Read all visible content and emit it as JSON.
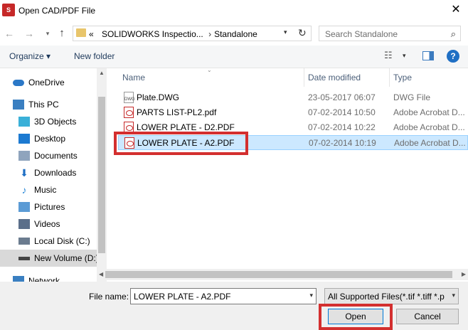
{
  "window": {
    "app_icon_text": "S",
    "title": "Open CAD/PDF File"
  },
  "address_bar": {
    "prefix": "«",
    "path": [
      "SOLIDWORKS Inspectio...",
      "Standalone"
    ],
    "separator": "›"
  },
  "search": {
    "placeholder": "Search Standalone"
  },
  "toolbar": {
    "organize_label": "Organize ▾",
    "new_folder_label": "New folder"
  },
  "sidebar": {
    "items": [
      {
        "label": "OneDrive",
        "icon": "onedrive-icon",
        "color": "#2b78c7"
      },
      {
        "label": "This PC",
        "icon": "computer-icon",
        "color": "#3a7fc1"
      },
      {
        "label": "3D Objects",
        "icon": "cube-icon",
        "color": "#3ab0d8"
      },
      {
        "label": "Desktop",
        "icon": "desktop-icon",
        "color": "#1c7ad1"
      },
      {
        "label": "Documents",
        "icon": "documents-icon",
        "color": "#8fa4bd"
      },
      {
        "label": "Downloads",
        "icon": "downloads-icon",
        "color": "#1f6fc4"
      },
      {
        "label": "Music",
        "icon": "music-icon",
        "color": "#2d8ad9"
      },
      {
        "label": "Pictures",
        "icon": "pictures-icon",
        "color": "#5b9bd5"
      },
      {
        "label": "Videos",
        "icon": "videos-icon",
        "color": "#5b6f8a"
      },
      {
        "label": "Local Disk (C:)",
        "icon": "local-disk-icon",
        "color": "#6b7c8f"
      },
      {
        "label": "New Volume (D:)",
        "icon": "drive-icon",
        "color": "#444444"
      },
      {
        "label": "Network",
        "icon": "network-icon",
        "color": "#3a7fc1"
      }
    ]
  },
  "file_list": {
    "columns": [
      "Name",
      "Date modified",
      "Type"
    ],
    "rows": [
      {
        "name": "Plate.DWG",
        "date": "23-05-2017 06:07",
        "type": "DWG File",
        "kind": "dwg"
      },
      {
        "name": "PARTS LIST-PL2.pdf",
        "date": "07-02-2014 10:50",
        "type": "Adobe Acrobat D...",
        "kind": "pdf"
      },
      {
        "name": "LOWER PLATE - D2.PDF",
        "date": "07-02-2014 10:22",
        "type": "Adobe Acrobat D...",
        "kind": "pdf"
      },
      {
        "name": "LOWER PLATE - A2.PDF",
        "date": "07-02-2014 10:19",
        "type": "Adobe Acrobat D...",
        "kind": "pdf",
        "selected": true
      }
    ]
  },
  "bottom": {
    "file_name_label": "File name:",
    "file_name_value": "LOWER PLATE - A2.PDF",
    "filter_value": "All Supported Files(*.tif *.tiff *.p",
    "open_label": "Open",
    "cancel_label": "Cancel"
  },
  "colors": {
    "highlight": "#d32f2f",
    "selection": "#cce8ff",
    "accent": "#0078d7"
  }
}
